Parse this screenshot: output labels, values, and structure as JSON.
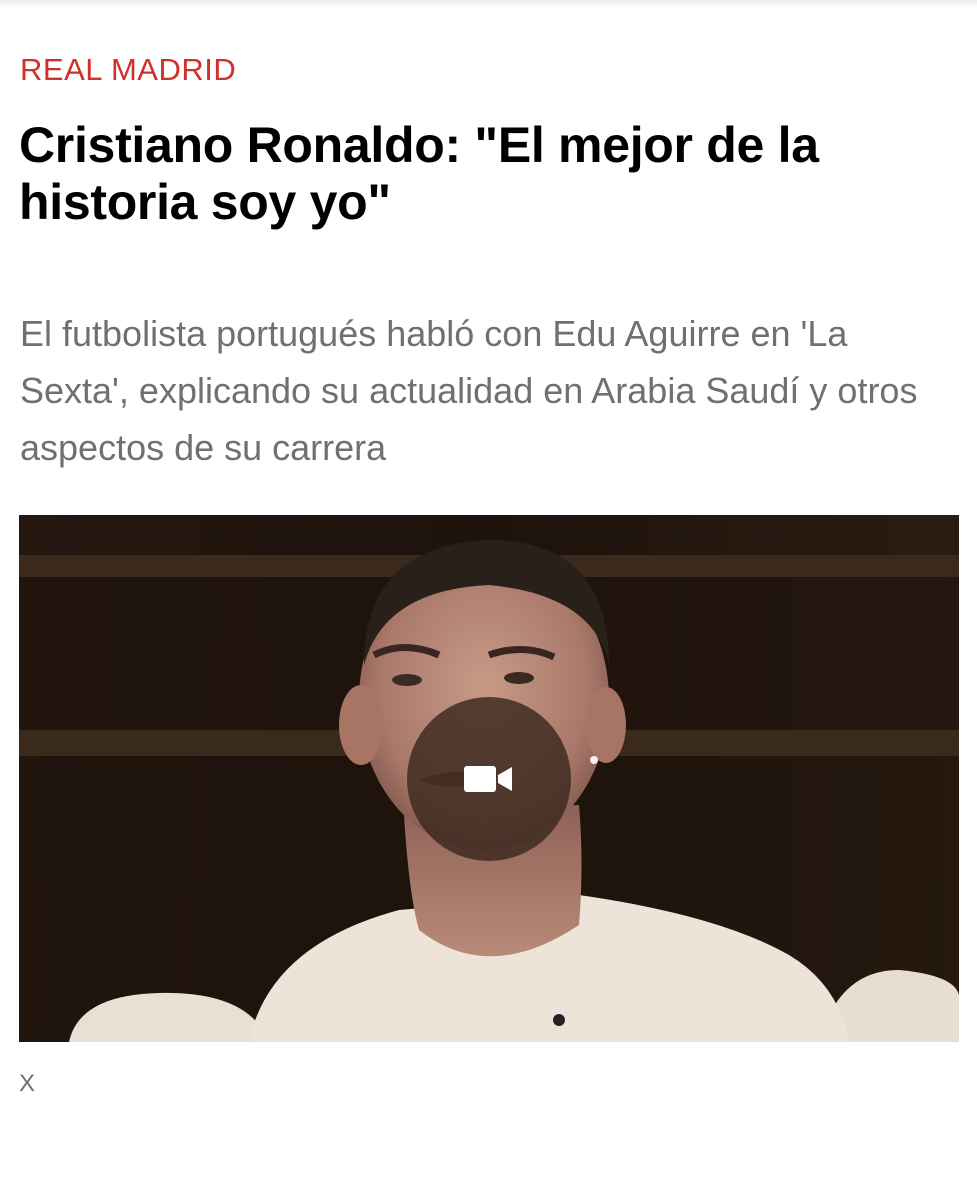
{
  "article": {
    "section": "REAL MADRID",
    "headline": "Cristiano Ronaldo: \"El mejor de la historia soy yo\"",
    "subtitle": "El futbolista portugués habló con Edu Aguirre en 'La Sexta', explicando su actualidad en Arabia Saudí y otros aspectos de su carrera",
    "media": {
      "icon": "video-camera-icon",
      "caption": "X"
    }
  },
  "colors": {
    "section_accent": "#d0302a",
    "headline": "#000000",
    "subtitle": "#707070",
    "play_overlay": "#3c281e"
  }
}
